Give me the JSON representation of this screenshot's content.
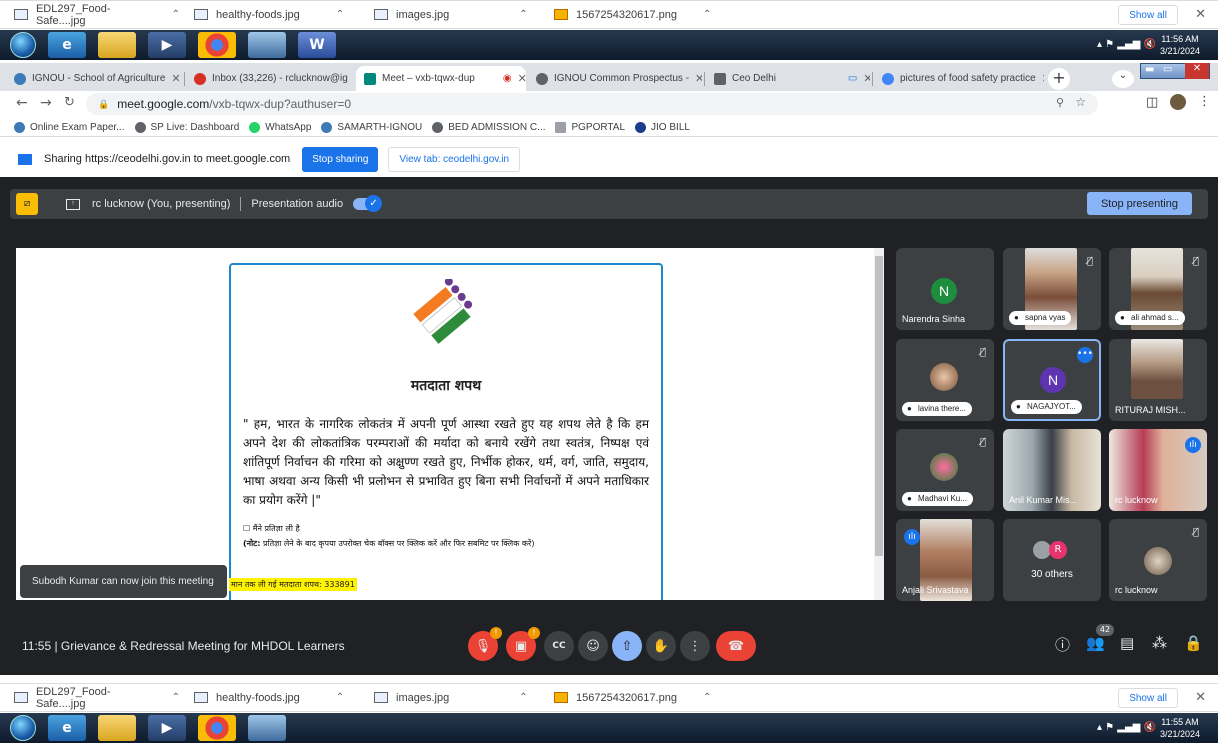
{
  "downloads": {
    "items": [
      "EDL297_Food-Safe....jpg",
      "healthy-foods.jpg",
      "images.jpg",
      "1567254320617.png"
    ],
    "show_all": "Show all"
  },
  "taskbar": {
    "time_top": "11:56 AM",
    "date_top": "3/21/2024",
    "time_bottom": "11:55 AM",
    "date_bottom": "3/21/2024"
  },
  "tabs": [
    {
      "title": "IGNOU - School of Agriculture",
      "color": "#3d7ab8"
    },
    {
      "title": "Inbox (33,226) - rclucknow@ig",
      "color": "#d93025"
    },
    {
      "title": "Meet – vxb-tqwx-dup",
      "color": "#00897b"
    },
    {
      "title": "IGNOU Common Prospectus -",
      "color": "#5f6368"
    },
    {
      "title": "Ceo Delhi",
      "color": "#5f6368"
    },
    {
      "title": "pictures of food safety practice",
      "color": "#4285f4"
    }
  ],
  "address": {
    "url_host": "meet.google.com",
    "url_path": "/vxb-tqwx-dup?authuser=0"
  },
  "bookmarks": [
    {
      "label": "Online Exam Paper...",
      "color": "#3d7ab8"
    },
    {
      "label": "SP Live: Dashboard",
      "color": "#5f6368"
    },
    {
      "label": "WhatsApp",
      "color": "#25d366"
    },
    {
      "label": "SAMARTH-IGNOU",
      "color": "#3d7ab8"
    },
    {
      "label": "BED ADMISSION C...",
      "color": "#5f6368"
    },
    {
      "label": "PGPORTAL",
      "color": "#9aa0a6"
    },
    {
      "label": "JIO BILL",
      "color": "#1c3c8c"
    }
  ],
  "share": {
    "text": "Sharing https://ceodelhi.gov.in to meet.google.com",
    "stop_sharing": "Stop sharing",
    "view_tab": "View tab: ceodelhi.gov.in"
  },
  "presenting": {
    "presenter": "rc lucknow (You, presenting)",
    "audio_label": "Presentation audio",
    "stop_presenting": "Stop presenting"
  },
  "oath": {
    "title": "मतदाता शपथ",
    "body": "\" हम, भारत के नागरिक लोकतंत्र में अपनी पूर्ण आस्था रखते हुए यह शपथ लेते है कि हम अपने देश की लोकतांत्रिक परम्पराओं की मर्यादा को बनाये रखेंगे तथा स्वतंत्र, निष्पक्ष एवं शांतिपूर्ण निर्वाचन की गरिमा को अक्षुण्ण रखते हुए, निर्भीक होकर, धर्म, वर्ग, जाति, समुदाय, भाषा अथवा अन्य किसी भी प्रलोभन से प्रभावित हुए बिना सभी निर्वाचनों में अपने मताधिकार का प्रयोग करेंगे |\"",
    "checkbox": "☐ मैंने प्रतिज्ञा ली है",
    "note_label": "(नोट:",
    "note": "प्रतिज्ञा लेने के बाद कृपया उपरोक्त चेक बॉक्स पर क्लिक करें और फिर सबमिट पर क्लिक करें)",
    "count": "मान तक ली गई मतदाता शपथ: 333891"
  },
  "toast": "Subodh Kumar can now join this meeting",
  "participants": {
    "narendra": "Narendra Sinha",
    "sapna": "sapna vyas",
    "ali": "ali ahmad s...",
    "lavina": "lavina there...",
    "nagajyot": "NAGAJYOT...",
    "rituraj": "RITURAJ MISH...",
    "madhavi": "Madhavi Ku...",
    "anil": "Anil Kumar Mis...",
    "rc1": "rc lucknow",
    "anjali": "Anjali Srivastava",
    "others": "30 others",
    "rc2": "rc lucknow",
    "avatar_n1": "N",
    "avatar_n2": "N",
    "avatar_r": "R"
  },
  "controls": {
    "meeting_info": "11:55  |  Grievance & Redressal Meeting for MHDOL Learners",
    "people_count": "42"
  }
}
